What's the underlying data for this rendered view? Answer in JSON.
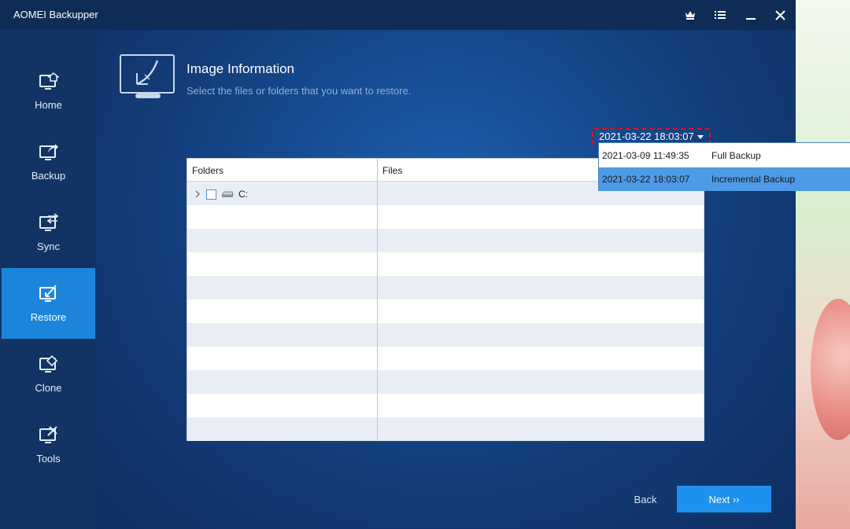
{
  "window": {
    "title": "AOMEI Backupper"
  },
  "titlebar_icons": [
    "crown-icon",
    "menu-icon",
    "minimize-icon",
    "close-icon"
  ],
  "sidebar": {
    "items": [
      {
        "label": "Home",
        "icon": "home-icon",
        "active": false
      },
      {
        "label": "Backup",
        "icon": "backup-icon",
        "active": false
      },
      {
        "label": "Sync",
        "icon": "sync-icon",
        "active": false
      },
      {
        "label": "Restore",
        "icon": "restore-icon",
        "active": true
      },
      {
        "label": "Clone",
        "icon": "clone-icon",
        "active": false
      },
      {
        "label": "Tools",
        "icon": "tools-icon",
        "active": false
      }
    ]
  },
  "header": {
    "title": "Image Information",
    "subtitle": "Select the files or folders that you want to restore."
  },
  "date_select": {
    "value": "2021-03-22 18:03:07"
  },
  "dropdown": {
    "options": [
      {
        "date": "2021-03-09 11:49:35",
        "type": "Full Backup",
        "selected": false
      },
      {
        "date": "2021-03-22 18:03:07",
        "type": "Incremental Backup",
        "selected": true
      }
    ]
  },
  "table": {
    "columns": [
      "Folders",
      "Files"
    ],
    "tree": [
      {
        "label": "C:",
        "checked": false,
        "expanded": false
      }
    ]
  },
  "footer": {
    "back_label": "Back",
    "next_label": "Next ››"
  },
  "colors": {
    "accent": "#1d84dc",
    "next_button": "#1e90ee",
    "selected_option": "#4d9be6",
    "highlight_border": "#e0101a"
  }
}
